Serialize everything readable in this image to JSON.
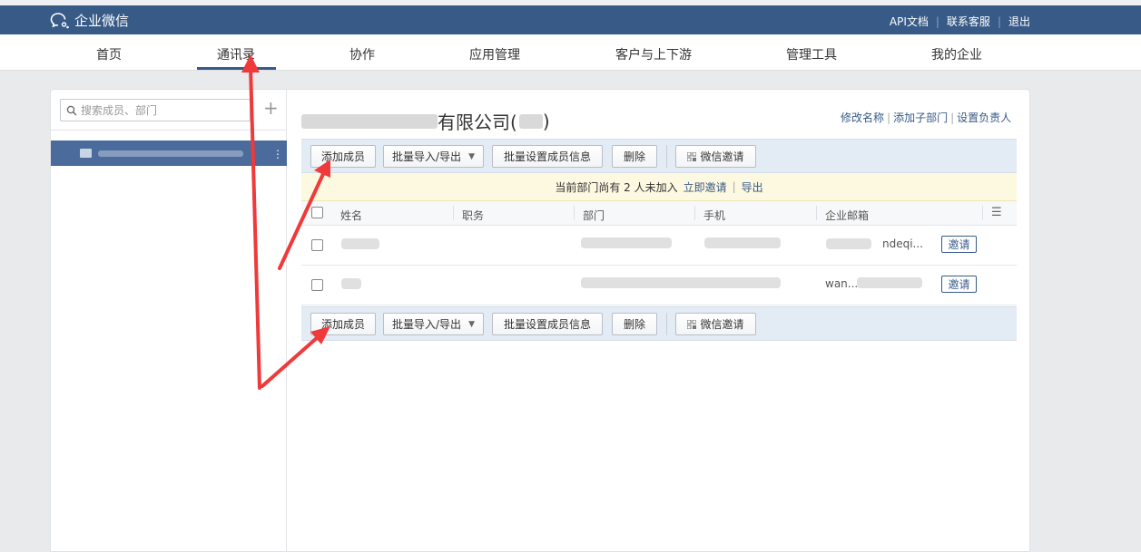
{
  "header": {
    "logo_text": "企业微信",
    "links": [
      "API文档",
      "联系客服",
      "退出"
    ],
    "brand_color": "#375a87"
  },
  "nav": {
    "items": [
      "首页",
      "通讯录",
      "协作",
      "应用管理",
      "客户与上下游",
      "管理工具",
      "我的企业"
    ],
    "active": "通讯录"
  },
  "sidebar": {
    "search_placeholder": "搜索成员、部门",
    "add_icon": "plus-icon"
  },
  "department": {
    "title_visible": "有限公司(",
    "actions": [
      "修改名称",
      "添加子部门",
      "设置负责人"
    ]
  },
  "toolbar": {
    "add_member": "添加成员",
    "batch_import_export": "批量导入/导出",
    "batch_set_info": "批量设置成员信息",
    "delete": "删除",
    "wechat_invite": "微信邀请"
  },
  "notice": {
    "text": "当前部门尚有 2 人未加入",
    "invite_link": "立即邀请",
    "export_link": "导出"
  },
  "table": {
    "columns": [
      "姓名",
      "职务",
      "部门",
      "手机",
      "企业邮箱"
    ],
    "rows": [
      {
        "email_partial": "ndeqi...",
        "invite_label": "邀请"
      },
      {
        "email_partial": "wan...",
        "invite_label": "邀请"
      }
    ]
  },
  "annotation_arrows": {
    "color": "#f0393a"
  }
}
